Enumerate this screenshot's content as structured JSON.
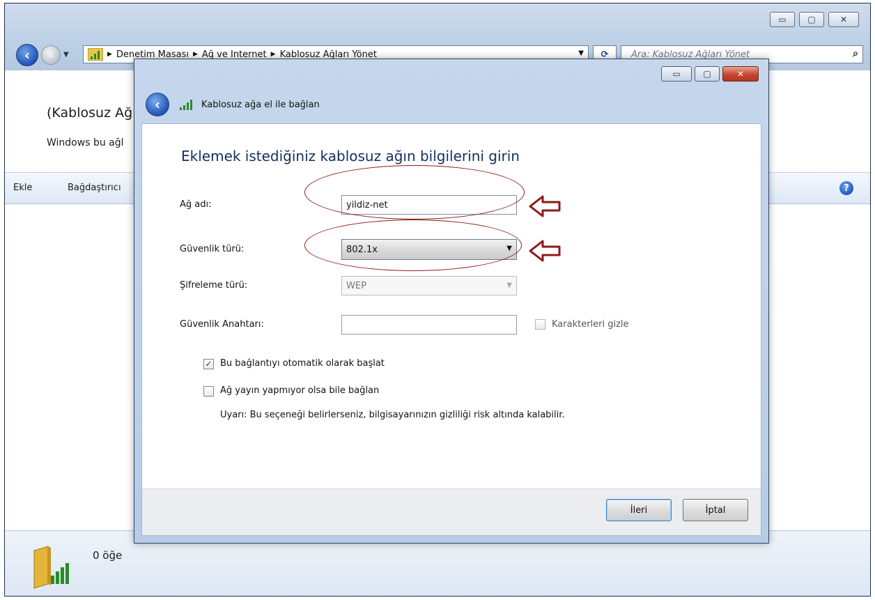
{
  "background_window": {
    "breadcrumbs": [
      "Denetim Masası",
      "Ağ ve Internet",
      "Kablosuz Ağları Yönet"
    ],
    "search_placeholder": "Ara: Kablosuz Ağları Yönet",
    "page_heading": "(Kablosuz Ağ",
    "page_description": "Windows bu ağl",
    "commands": {
      "add": "Ekle",
      "adapter": "Bağdaştırıcı"
    },
    "help_glyph": "?",
    "status_count": "0 öğe"
  },
  "dialog": {
    "title": "Kablosuz ağa el ile bağlan",
    "instruction": "Eklemek istediğiniz kablosuz ağın bilgilerini girin",
    "fields": {
      "ssid_label": "Ağ adı:",
      "ssid_value": "yildiz-net",
      "security_label": "Güvenlik türü:",
      "security_value": "802.1x",
      "encryption_label": "Şifreleme türü:",
      "encryption_value": "WEP",
      "key_label": "Güvenlik Anahtarı:",
      "key_value": "",
      "hide_chars_label": "Karakterleri gizle"
    },
    "options": {
      "auto_start_label": "Bu bağlantıyı otomatik olarak başlat",
      "auto_start_checked": true,
      "hidden_network_label": "Ağ yayın yapmıyor olsa bile bağlan",
      "hidden_network_checked": false,
      "warning": "Uyarı: Bu seçeneği belirlerseniz, bilgisayarınızın gizliliği risk altında kalabilir."
    },
    "buttons": {
      "next": "İleri",
      "cancel": "İptal"
    }
  },
  "icons": {
    "back": "back-arrow-icon",
    "signal": "wifi-signal-icon",
    "search": "search-icon",
    "help": "help-icon",
    "annotation_arrow": "red-arrow-icon"
  },
  "colors": {
    "annotation": "#8c1a1a",
    "title_text": "#12305e",
    "close_button": "#c7472f"
  }
}
